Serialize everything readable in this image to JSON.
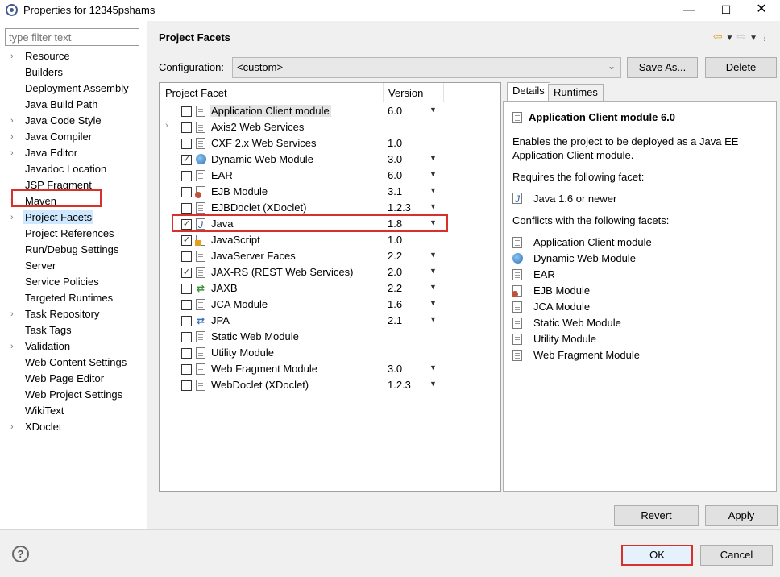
{
  "window": {
    "title": "Properties for 12345pshams",
    "controls": [
      "minimize",
      "maximize",
      "close"
    ]
  },
  "sidebar": {
    "filter_placeholder": "type filter text",
    "items": [
      {
        "label": "Resource",
        "expandable": true
      },
      {
        "label": "Builders",
        "expandable": false
      },
      {
        "label": "Deployment Assembly",
        "expandable": false
      },
      {
        "label": "Java Build Path",
        "expandable": false
      },
      {
        "label": "Java Code Style",
        "expandable": true
      },
      {
        "label": "Java Compiler",
        "expandable": true
      },
      {
        "label": "Java Editor",
        "expandable": true
      },
      {
        "label": "Javadoc Location",
        "expandable": false
      },
      {
        "label": "JSP Fragment",
        "expandable": false
      },
      {
        "label": "Maven",
        "expandable": true
      },
      {
        "label": "Project Facets",
        "expandable": true,
        "selected": true
      },
      {
        "label": "Project References",
        "expandable": false
      },
      {
        "label": "Run/Debug Settings",
        "expandable": false
      },
      {
        "label": "Server",
        "expandable": false
      },
      {
        "label": "Service Policies",
        "expandable": false
      },
      {
        "label": "Targeted Runtimes",
        "expandable": false
      },
      {
        "label": "Task Repository",
        "expandable": true
      },
      {
        "label": "Task Tags",
        "expandable": false
      },
      {
        "label": "Validation",
        "expandable": true
      },
      {
        "label": "Web Content Settings",
        "expandable": false
      },
      {
        "label": "Web Page Editor",
        "expandable": false
      },
      {
        "label": "Web Project Settings",
        "expandable": false
      },
      {
        "label": "WikiText",
        "expandable": false
      },
      {
        "label": "XDoclet",
        "expandable": true
      }
    ]
  },
  "header": {
    "title": "Project Facets"
  },
  "configuration": {
    "label": "Configuration:",
    "value": "<custom>",
    "save_as_label": "Save As...",
    "delete_label": "Delete"
  },
  "facets": {
    "col_facet": "Project Facet",
    "col_version": "Version",
    "rows": [
      {
        "name": "Application Client module",
        "version": "6.0",
        "checked": false,
        "dropdown": true,
        "icon": "page-icon",
        "highlighted": true
      },
      {
        "name": "Axis2 Web Services",
        "version": "",
        "checked": false,
        "dropdown": false,
        "icon": "page-icon",
        "expandable": true
      },
      {
        "name": "CXF 2.x Web Services",
        "version": "1.0",
        "checked": false,
        "dropdown": false,
        "icon": "page-icon"
      },
      {
        "name": "Dynamic Web Module",
        "version": "3.0",
        "checked": true,
        "dropdown": true,
        "icon": "globe-icon"
      },
      {
        "name": "EAR",
        "version": "6.0",
        "checked": false,
        "dropdown": true,
        "icon": "page-icon"
      },
      {
        "name": "EJB Module",
        "version": "3.1",
        "checked": false,
        "dropdown": true,
        "icon": "bean-icon"
      },
      {
        "name": "EJBDoclet (XDoclet)",
        "version": "1.2.3",
        "checked": false,
        "dropdown": true,
        "icon": "page-icon"
      },
      {
        "name": "Java",
        "version": "1.8",
        "checked": true,
        "dropdown": true,
        "icon": "java-icon"
      },
      {
        "name": "JavaScript",
        "version": "1.0",
        "checked": true,
        "dropdown": false,
        "icon": "javascript-icon"
      },
      {
        "name": "JavaServer Faces",
        "version": "2.2",
        "checked": false,
        "dropdown": true,
        "icon": "page-icon"
      },
      {
        "name": "JAX-RS (REST Web Services)",
        "version": "2.0",
        "checked": true,
        "dropdown": true,
        "icon": "page-icon"
      },
      {
        "name": "JAXB",
        "version": "2.2",
        "checked": false,
        "dropdown": true,
        "icon": "jaxb-icon"
      },
      {
        "name": "JCA Module",
        "version": "1.6",
        "checked": false,
        "dropdown": true,
        "icon": "page-icon"
      },
      {
        "name": "JPA",
        "version": "2.1",
        "checked": false,
        "dropdown": true,
        "icon": "jpa-icon"
      },
      {
        "name": "Static Web Module",
        "version": "",
        "checked": false,
        "dropdown": false,
        "icon": "page-icon"
      },
      {
        "name": "Utility Module",
        "version": "",
        "checked": false,
        "dropdown": false,
        "icon": "page-icon"
      },
      {
        "name": "Web Fragment Module",
        "version": "3.0",
        "checked": false,
        "dropdown": true,
        "icon": "page-icon"
      },
      {
        "name": "WebDoclet (XDoclet)",
        "version": "1.2.3",
        "checked": false,
        "dropdown": true,
        "icon": "page-icon"
      }
    ]
  },
  "details": {
    "tab_details": "Details",
    "tab_runtimes": "Runtimes",
    "title": "Application Client module 6.0",
    "description": "Enables the project to be deployed as a Java EE Application Client module.",
    "requires_label": "Requires the following facet:",
    "requires_item": "Java 1.6 or newer",
    "conflicts_label": "Conflicts with the following facets:",
    "conflicts": [
      {
        "label": "Application Client module",
        "icon": "page-icon"
      },
      {
        "label": "Dynamic Web Module",
        "icon": "globe-icon"
      },
      {
        "label": "EAR",
        "icon": "page-icon"
      },
      {
        "label": "EJB Module",
        "icon": "bean-icon"
      },
      {
        "label": "JCA Module",
        "icon": "page-icon"
      },
      {
        "label": "Static Web Module",
        "icon": "page-icon"
      },
      {
        "label": "Utility Module",
        "icon": "page-icon"
      },
      {
        "label": "Web Fragment Module",
        "icon": "page-icon"
      }
    ]
  },
  "buttons": {
    "revert": "Revert",
    "apply": "Apply",
    "ok": "OK",
    "cancel": "Cancel"
  },
  "colors": {
    "highlight_border": "#d9302c",
    "selection": "#cde8ff"
  }
}
